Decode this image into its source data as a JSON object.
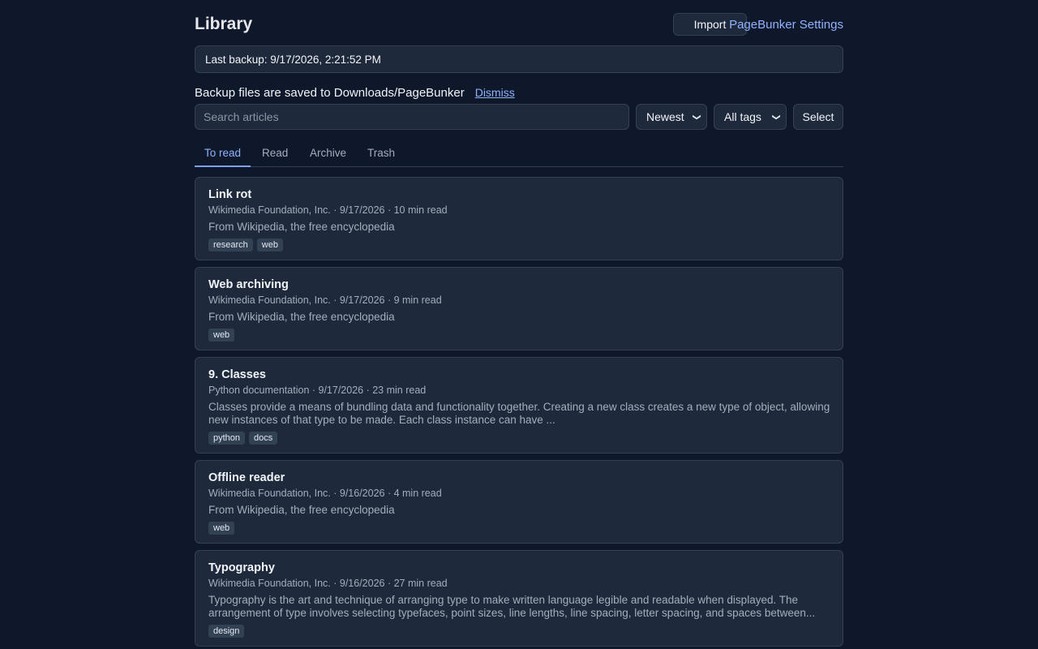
{
  "header": {
    "title": "Library",
    "import_label": "Import",
    "settings_label": "PageBunker Settings"
  },
  "backup": {
    "status": "Last backup: 9/17/2026, 2:21:52 PM"
  },
  "notice": {
    "text": "Backup files are saved to Downloads/PageBunker",
    "dismiss_label": "Dismiss"
  },
  "controls": {
    "search_placeholder": "Search articles",
    "sort_value": "Newest",
    "tag_filter_value": "All tags",
    "select_label": "Select"
  },
  "tabs": [
    {
      "label": "To read",
      "active": true
    },
    {
      "label": "Read",
      "active": false
    },
    {
      "label": "Archive",
      "active": false
    },
    {
      "label": "Trash",
      "active": false
    }
  ],
  "articles": [
    {
      "title": "Link rot",
      "meta": "Wikimedia Foundation, Inc. · 9/17/2026 · 10 min read",
      "excerpt": "From Wikipedia, the free encyclopedia",
      "tags": [
        "research",
        "web"
      ]
    },
    {
      "title": "Web archiving",
      "meta": "Wikimedia Foundation, Inc. · 9/17/2026 · 9 min read",
      "excerpt": "From Wikipedia, the free encyclopedia",
      "tags": [
        "web"
      ]
    },
    {
      "title": "9. Classes",
      "meta": "Python documentation · 9/17/2026 · 23 min read",
      "excerpt": "Classes provide a means of bundling data and functionality together. Creating a new class creates a new type of object, allowing new instances of that type to be made. Each class instance can have ...",
      "tags": [
        "python",
        "docs"
      ]
    },
    {
      "title": "Offline reader",
      "meta": "Wikimedia Foundation, Inc. · 9/16/2026 · 4 min read",
      "excerpt": "From Wikipedia, the free encyclopedia",
      "tags": [
        "web"
      ]
    },
    {
      "title": "Typography",
      "meta": "Wikimedia Foundation, Inc. · 9/16/2026 · 27 min read",
      "excerpt": "Typography is the art and technique of arranging type to make written language legible and readable when displayed. The arrangement of type involves selecting typefaces, point sizes, line lengths, line spacing, letter spacing, and spaces between...",
      "tags": [
        "design"
      ]
    }
  ]
}
